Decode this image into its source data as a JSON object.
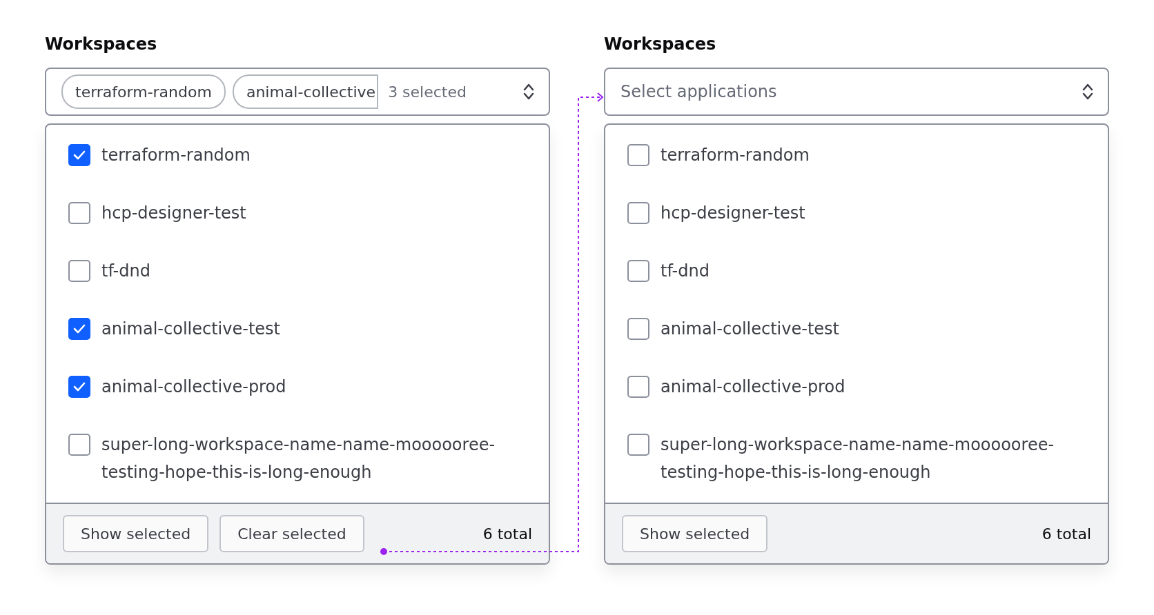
{
  "panels": [
    {
      "label": "Workspaces",
      "combobox": {
        "chips": [
          {
            "text": "terraform-random",
            "cut": false
          },
          {
            "text": "animal-collective",
            "cut": true
          }
        ],
        "summary": "3 selected"
      },
      "options": [
        {
          "label": "terraform-random",
          "checked": true
        },
        {
          "label": "hcp-designer-test",
          "checked": false
        },
        {
          "label": "tf-dnd",
          "checked": false
        },
        {
          "label": "animal-collective-test",
          "checked": true
        },
        {
          "label": "animal-collective-prod",
          "checked": true
        },
        {
          "label": "super-long-workspace-name-name-moooooree-testing-hope-this-is-long-enough",
          "checked": false
        }
      ],
      "footer": {
        "buttons": [
          "Show selected",
          "Clear selected"
        ],
        "total": "6 total"
      }
    },
    {
      "label": "Workspaces",
      "combobox": {
        "placeholder": "Select applications"
      },
      "options": [
        {
          "label": "terraform-random",
          "checked": false
        },
        {
          "label": "hcp-designer-test",
          "checked": false
        },
        {
          "label": "tf-dnd",
          "checked": false
        },
        {
          "label": "animal-collective-test",
          "checked": false
        },
        {
          "label": "animal-collective-prod",
          "checked": false
        },
        {
          "label": "super-long-workspace-name-name-moooooree-testing-hope-this-is-long-enough",
          "checked": false
        }
      ],
      "footer": {
        "buttons": [
          "Show selected"
        ],
        "total": "6 total"
      }
    }
  ]
}
